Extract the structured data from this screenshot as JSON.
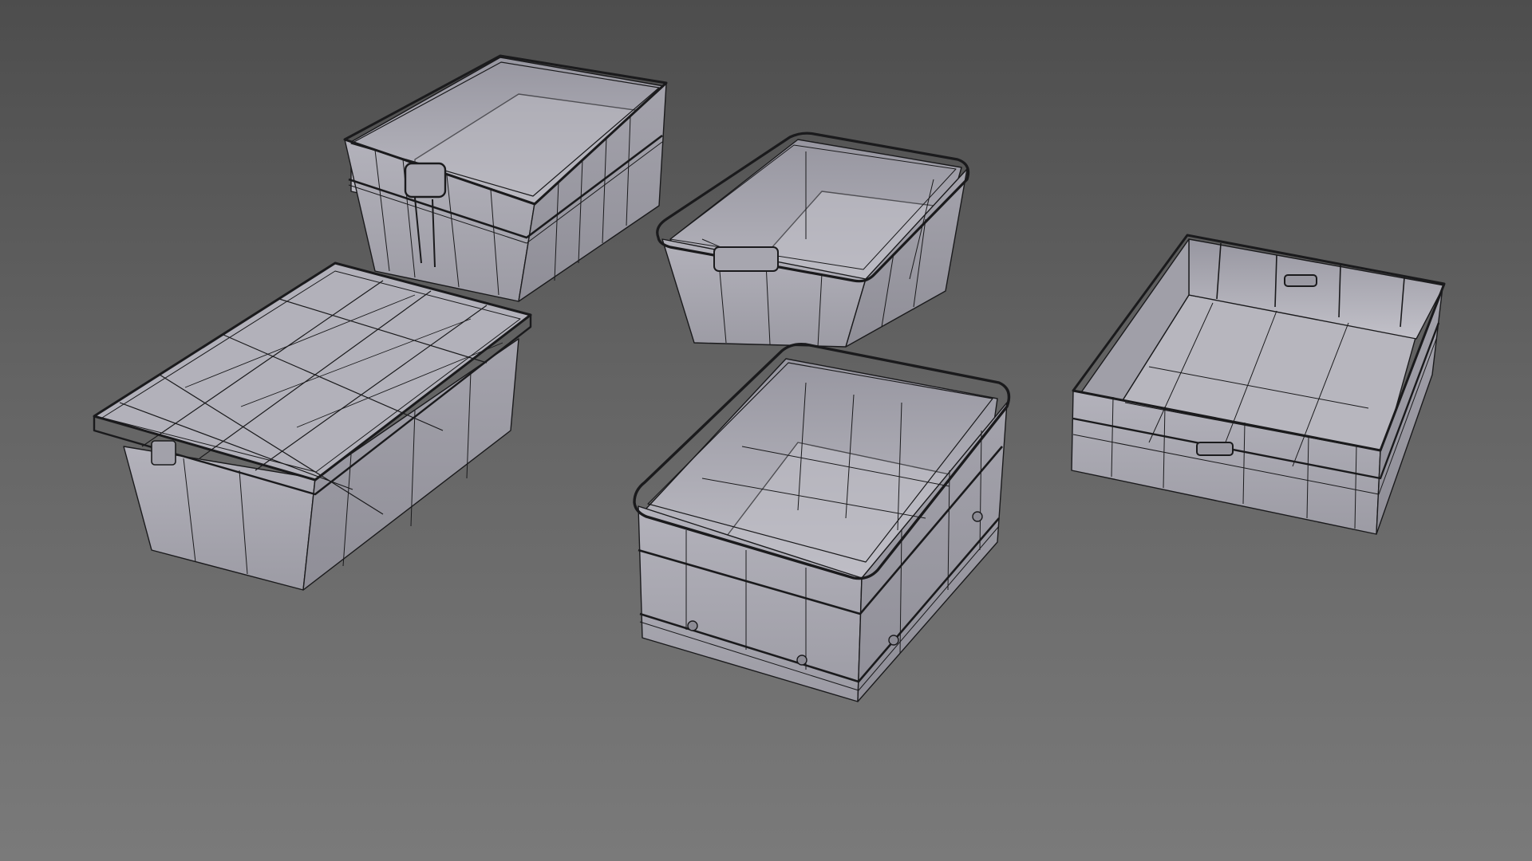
{
  "scene": {
    "background_top": "#4d4d4d",
    "background_bottom": "#7a7a7a",
    "mesh_fill": "#a9a8b1",
    "mesh_fill_dark": "#8e8d96",
    "mesh_fill_inner": "#bdbcc4",
    "wire_color": "#1a1a1c",
    "objects": [
      {
        "name": "crate-tall-back-left",
        "kind": "open crate with side handle"
      },
      {
        "name": "crate-lidded-front-left",
        "kind": "closed storage box with lid"
      },
      {
        "name": "bin-back-center",
        "kind": "open tapered bin"
      },
      {
        "name": "crate-front-center",
        "kind": "open stacking crate"
      },
      {
        "name": "tray-right",
        "kind": "shallow open tray"
      }
    ]
  }
}
